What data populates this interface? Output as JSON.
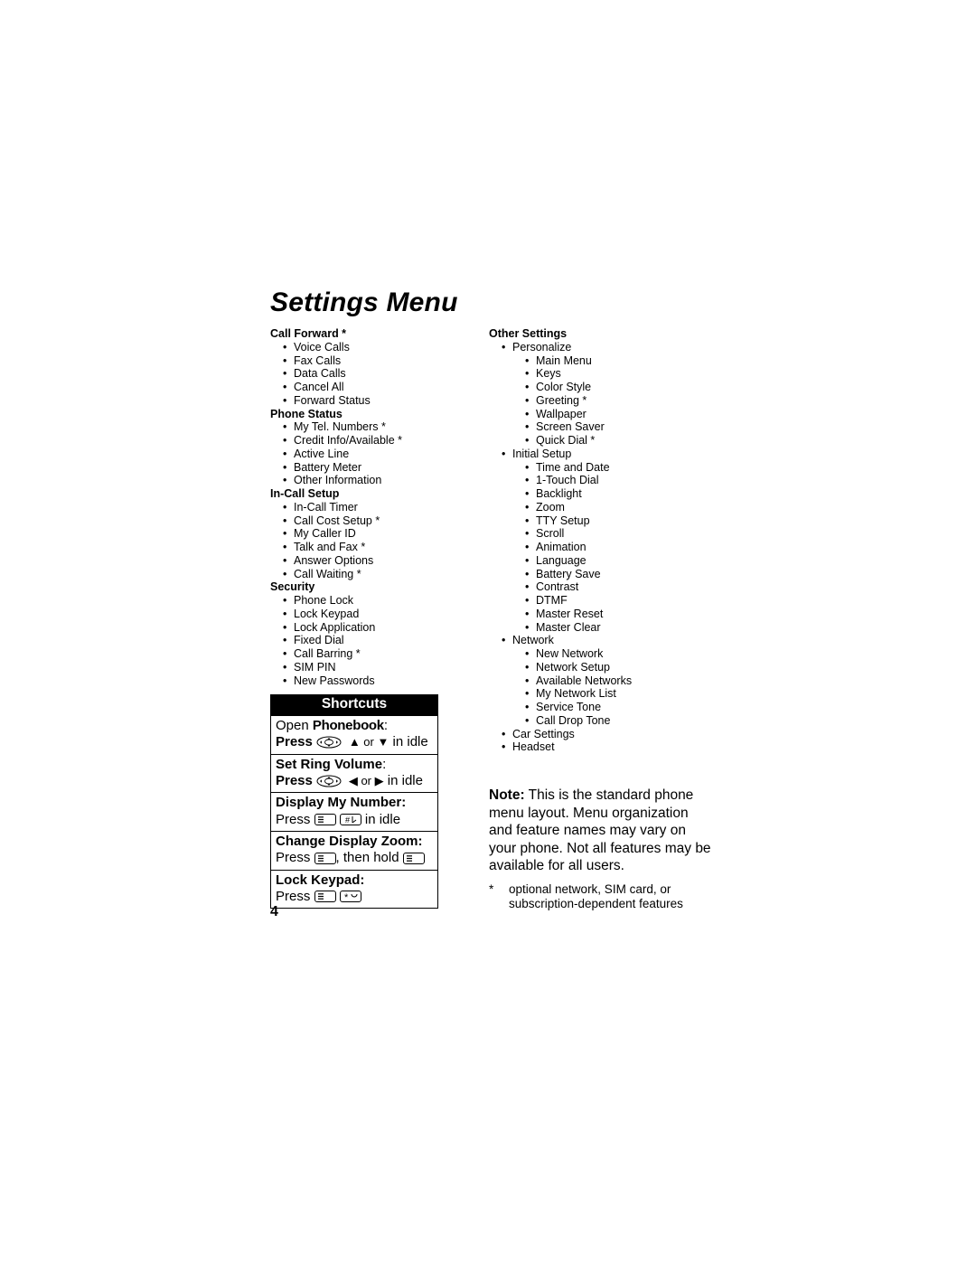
{
  "title": "Settings Menu",
  "page_number": "4",
  "left_sections": [
    {
      "title": "Call Forward *",
      "items": [
        {
          "t": "Voice Calls"
        },
        {
          "t": "Fax Calls"
        },
        {
          "t": "Data Calls"
        },
        {
          "t": "Cancel All"
        },
        {
          "t": "Forward Status"
        }
      ]
    },
    {
      "title": "Phone Status",
      "items": [
        {
          "t": "My Tel. Numbers *"
        },
        {
          "t": "Credit Info/Available *"
        },
        {
          "t": "Active Line"
        },
        {
          "t": "Battery Meter"
        },
        {
          "t": "Other Information"
        }
      ]
    },
    {
      "title": "In-Call Setup",
      "items": [
        {
          "t": "In-Call Timer"
        },
        {
          "t": "Call Cost Setup *"
        },
        {
          "t": "My Caller ID"
        },
        {
          "t": "Talk and Fax *"
        },
        {
          "t": "Answer Options"
        },
        {
          "t": "Call Waiting *"
        }
      ]
    },
    {
      "title": "Security",
      "items": [
        {
          "t": "Phone Lock"
        },
        {
          "t": "Lock Keypad"
        },
        {
          "t": "Lock Application"
        },
        {
          "t": "Fixed Dial"
        },
        {
          "t": "Call Barring *"
        },
        {
          "t": "SIM PIN"
        },
        {
          "t": "New Passwords"
        }
      ]
    }
  ],
  "right_sections": [
    {
      "title": "Other Settings",
      "items": [
        {
          "t": "Personalize",
          "children": [
            {
              "t": "Main Menu"
            },
            {
              "t": "Keys"
            },
            {
              "t": "Color Style"
            },
            {
              "t": "Greeting *"
            },
            {
              "t": "Wallpaper"
            },
            {
              "t": "Screen Saver"
            },
            {
              "t": "Quick Dial *"
            }
          ]
        },
        {
          "t": "Initial Setup",
          "children": [
            {
              "t": "Time and Date"
            },
            {
              "t": "1-Touch Dial"
            },
            {
              "t": "Backlight"
            },
            {
              "t": "Zoom"
            },
            {
              "t": "TTY Setup"
            },
            {
              "t": "Scroll"
            },
            {
              "t": "Animation"
            },
            {
              "t": "Language"
            },
            {
              "t": "Battery Save"
            },
            {
              "t": "Contrast"
            },
            {
              "t": "DTMF"
            },
            {
              "t": "Master Reset"
            },
            {
              "t": "Master Clear"
            }
          ]
        },
        {
          "t": "Network",
          "children": [
            {
              "t": "New Network"
            },
            {
              "t": "Network Setup"
            },
            {
              "t": "Available Networks"
            },
            {
              "t": "My Network List"
            },
            {
              "t": "Service Tone"
            },
            {
              "t": "Call Drop Tone"
            }
          ]
        },
        {
          "t": "Car Settings"
        },
        {
          "t": "Headset"
        }
      ]
    }
  ],
  "shortcuts": {
    "header": "Shortcuts",
    "rows": [
      {
        "line1_a": "Open ",
        "line1_b": "Phonebook",
        "line1_c": ":",
        "line2_a": "Press ",
        "nav": true,
        "arrows": "ud",
        "line2_tail": " in idle"
      },
      {
        "line1_a": "Set Ring Volume",
        "line1_b": "",
        "line1_c": ":",
        "line2_a": "Press ",
        "nav": true,
        "arrows": "lr",
        "line2_tail": " in idle"
      },
      {
        "line1_a": "Display My Number:",
        "line1_b": "",
        "line1_c": "",
        "line2_a": "Press ",
        "keys": [
          "menu",
          "hash"
        ],
        "line2_tail": " in idle"
      },
      {
        "line1_a": "Change Display Zoom:",
        "line1_b": "",
        "line1_c": "",
        "line2_a": "Press ",
        "keys": [
          "menu"
        ],
        "mid": ", then hold ",
        "keys2": [
          "menu"
        ],
        "line2_tail": ""
      },
      {
        "line1_a": "Lock Keypad:",
        "line1_b": "",
        "line1_c": "",
        "line2_a": "Press ",
        "keys": [
          "menu",
          "star"
        ],
        "line2_tail": ""
      }
    ]
  },
  "note": {
    "label": "Note:",
    "text": " This is the standard phone menu layout. Menu organization and feature names may vary on your phone. Not all features may be available for all users."
  },
  "footnote": {
    "ast": "*",
    "text": "optional network, SIM card, or subscription-dependent features"
  },
  "glyphs": {
    "up": "▲",
    "down": "▼",
    "left": "◀",
    "right": "▶",
    "or": " or "
  }
}
